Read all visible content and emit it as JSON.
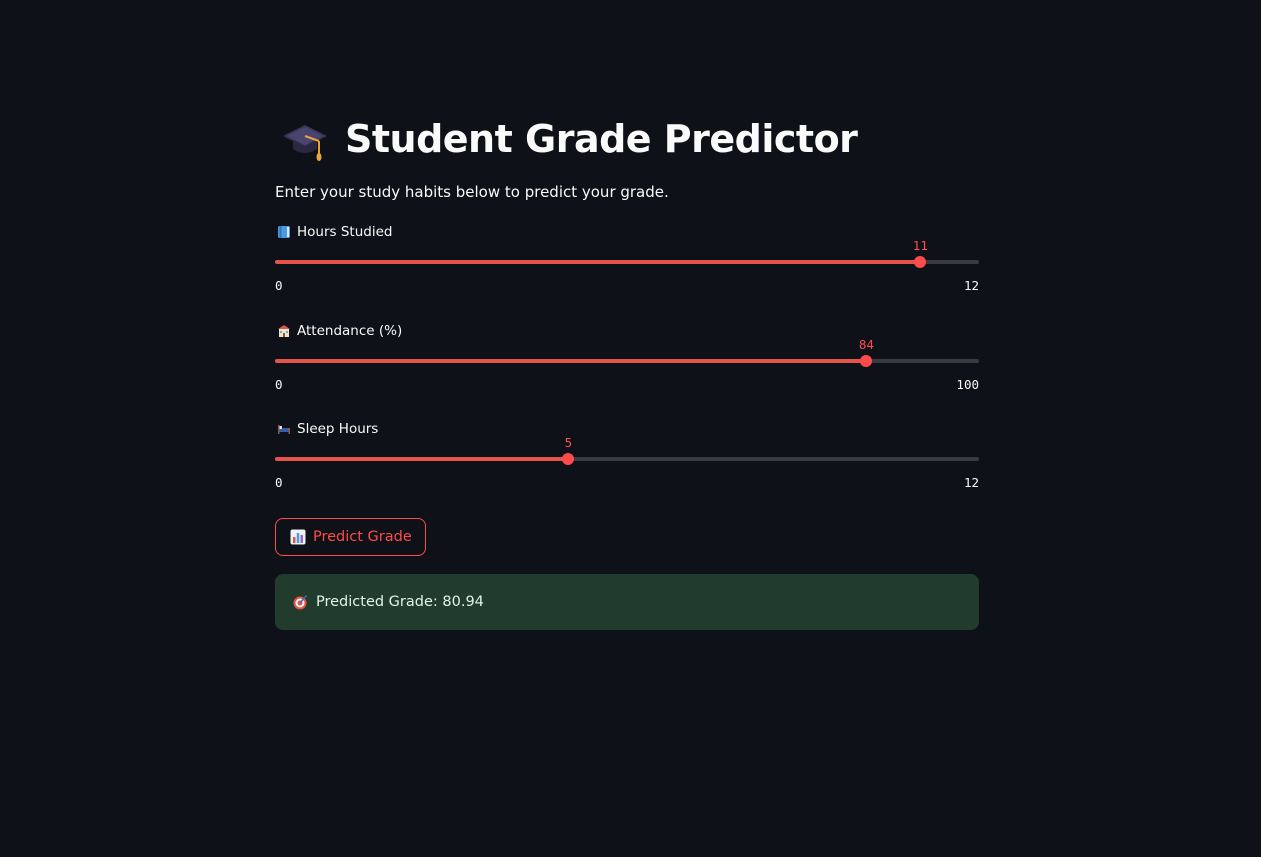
{
  "app": {
    "title": "Student Grade Predictor",
    "title_icon": "graduation-cap-icon",
    "subtitle": "Enter your study habits below to predict your grade.",
    "accent_color": "#ff4b4b",
    "background_color": "#0e1117"
  },
  "sliders": [
    {
      "label": "Hours Studied",
      "icon": "book-icon",
      "min_label": "0",
      "max_label": "12",
      "min": 0,
      "max": 12,
      "value": 11,
      "value_label": "11"
    },
    {
      "label": "Attendance (%)",
      "icon": "school-icon",
      "min_label": "0",
      "max_label": "100",
      "min": 0,
      "max": 100,
      "value": 84,
      "value_label": "84"
    },
    {
      "label": "Sleep Hours",
      "icon": "bed-icon",
      "min_label": "0",
      "max_label": "12",
      "min": 0,
      "max": 12,
      "value": 5,
      "value_label": "5"
    }
  ],
  "predict_button": {
    "label": "Predict Grade",
    "icon": "bar-chart-icon"
  },
  "result": {
    "text": "Predicted Grade: 80.94",
    "icon": "target-icon",
    "background_color": "#213b2c"
  }
}
